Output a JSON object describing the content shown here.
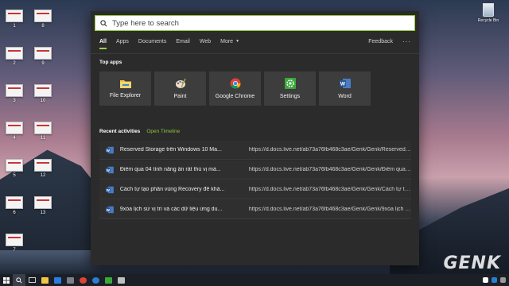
{
  "search": {
    "placeholder": "Type here to search"
  },
  "tabs": [
    {
      "label": "All",
      "active": true
    },
    {
      "label": "Apps"
    },
    {
      "label": "Documents"
    },
    {
      "label": "Email"
    },
    {
      "label": "Web"
    },
    {
      "label": "More"
    }
  ],
  "feedback_label": "Feedback",
  "more_options": "···",
  "top_apps_title": "Top apps",
  "apps": [
    {
      "label": "File Explorer",
      "icon": "folder-icon"
    },
    {
      "label": "Paint",
      "icon": "paint-icon"
    },
    {
      "label": "Google Chrome",
      "icon": "chrome-icon"
    },
    {
      "label": "Settings",
      "icon": "gear-icon"
    },
    {
      "label": "Word",
      "icon": "word-icon"
    }
  ],
  "recent_title": "Recent activities",
  "open_timeline": "Open Timeline",
  "recent": [
    {
      "name": "Reserved Storage trên Windows 10 Ma...",
      "url": "https://d.docs.live.net/ab73a76fb468c3ae/Genk/Genk/Reserved St..."
    },
    {
      "name": "Điểm qua 04 tính năng ẩn rất thú vị mà...",
      "url": "https://d.docs.live.net/ab73a76fb468c3ae/Genk/Genk/Điểm qua 0..."
    },
    {
      "name": "Cách tự tạo phân vùng Recovery để khả...",
      "url": "https://d.docs.live.net/ab73a76fb468c3ae/Genk/Genk/Cách tự tạo ..."
    },
    {
      "name": "9xóa lịch sử vị trí và các dữ liệu ứng du...",
      "url": "https://d.docs.live.net/ab73a76fb468c3ae/Genk/Genk/9xóa lịch sử..."
    }
  ],
  "desktop_icons": [
    "1",
    "2",
    "3",
    "4",
    "5",
    "6",
    "7",
    "8",
    "9",
    "10",
    "11",
    "12",
    "13"
  ],
  "recycle_bin_label": "Recycle Bin",
  "watermark": "GENK",
  "colors": {
    "accent": "#8fc63a",
    "panel": "#2b2b2b",
    "tile": "#3d3d3d",
    "word_blue": "#2b5797"
  }
}
